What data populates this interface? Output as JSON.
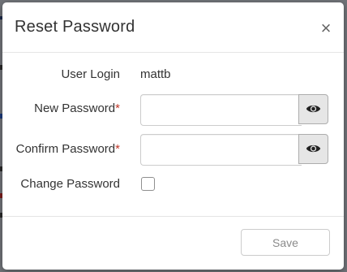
{
  "dialog": {
    "title": "Reset Password",
    "close_symbol": "×"
  },
  "form": {
    "user_login_label": "User Login",
    "user_login_value": "mattb",
    "new_password_label": "New Password",
    "confirm_password_label": "Confirm Password",
    "required_marker": "*",
    "change_password_label": "Change Password",
    "new_password_value": "",
    "confirm_password_value": "",
    "change_password_checked": false,
    "reveal_icon": "eye-icon"
  },
  "footer": {
    "save_label": "Save",
    "save_disabled": true
  },
  "colors": {
    "required": "#c0392b",
    "backdrop": "#707378"
  }
}
